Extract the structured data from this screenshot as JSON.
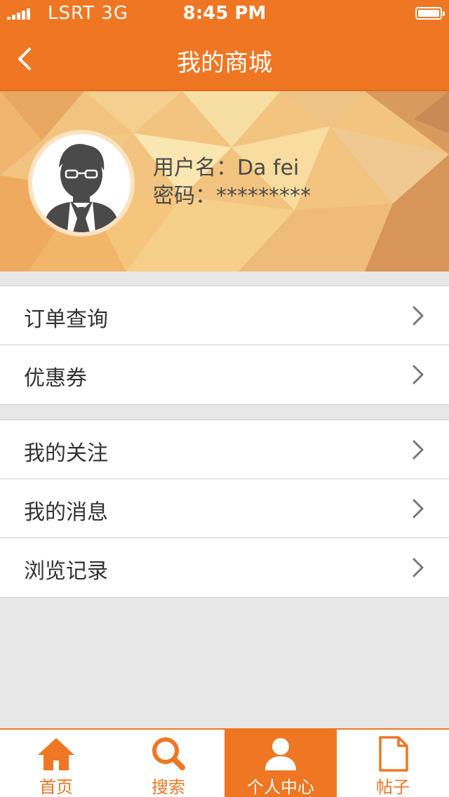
{
  "status_bar": {
    "carrier": "LSRT 3G",
    "time": "8:45 PM"
  },
  "nav": {
    "title": "我的商城",
    "back_icon": "chevron-left-icon"
  },
  "profile": {
    "username_line": "用户名：Da fei",
    "password_line": "密码：*********"
  },
  "menu_groups": [
    {
      "items": [
        {
          "label": "订单查询"
        },
        {
          "label": "优惠券"
        }
      ]
    },
    {
      "items": [
        {
          "label": "我的关注"
        },
        {
          "label": "我的消息"
        },
        {
          "label": "浏览记录"
        }
      ]
    }
  ],
  "tabs": [
    {
      "label": "首页",
      "icon": "home-icon"
    },
    {
      "label": "搜索",
      "icon": "search-icon"
    },
    {
      "label": "个人中心",
      "icon": "person-icon",
      "active": true
    },
    {
      "label": "帖子",
      "icon": "document-icon"
    }
  ],
  "colors": {
    "accent": "#ef7622",
    "background": "#e8e8e8"
  }
}
